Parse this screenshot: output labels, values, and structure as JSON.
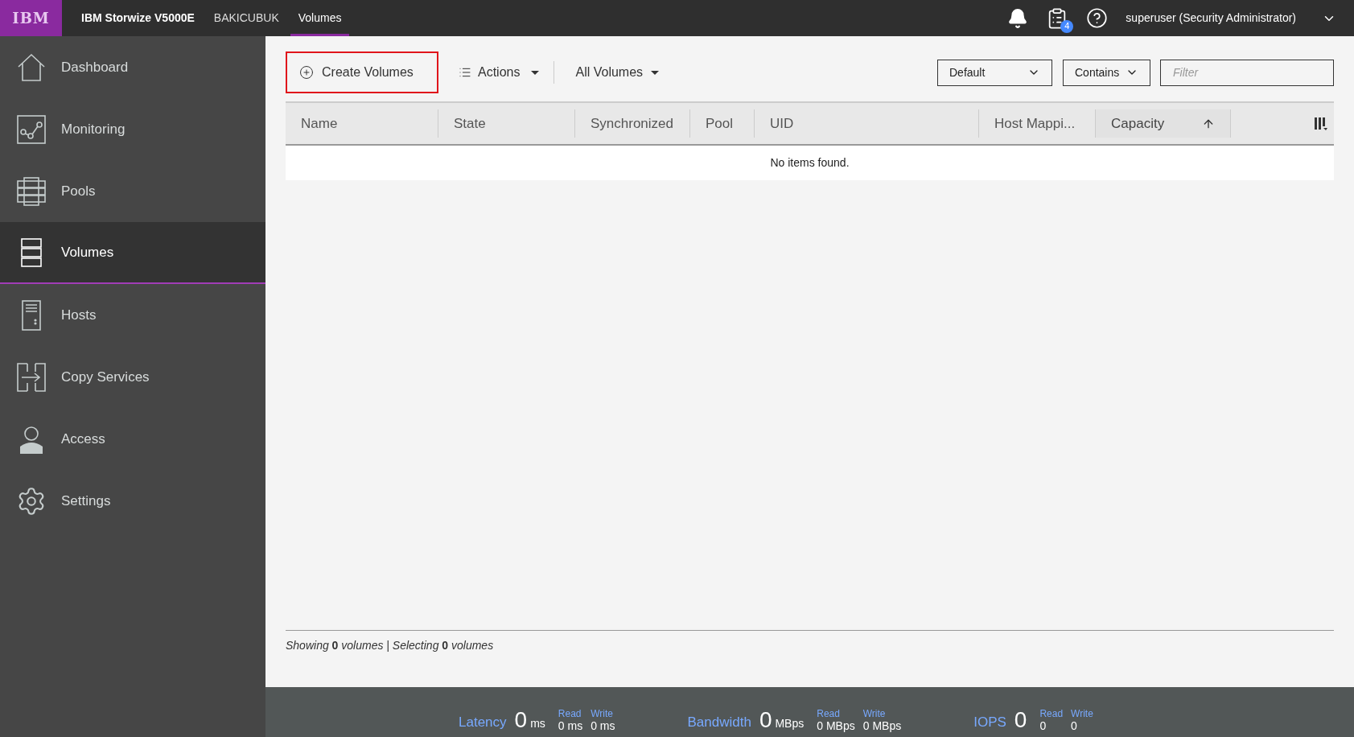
{
  "topbar": {
    "logo": "IBM",
    "product": "IBM Storwize V5000E",
    "system": "BAKICUBUK",
    "current": "Volumes",
    "tasks_badge": "4",
    "user": "superuser (Security Administrator)"
  },
  "sidebar": {
    "items": [
      {
        "label": "Dashboard",
        "selected": false
      },
      {
        "label": "Monitoring",
        "selected": false
      },
      {
        "label": "Pools",
        "selected": false
      },
      {
        "label": "Volumes",
        "selected": true
      },
      {
        "label": "Hosts",
        "selected": false
      },
      {
        "label": "Copy Services",
        "selected": false
      },
      {
        "label": "Access",
        "selected": false
      },
      {
        "label": "Settings",
        "selected": false
      }
    ]
  },
  "toolbar": {
    "create": "Create Volumes",
    "actions": "Actions",
    "view": "All Volumes",
    "filter_scope": "Default",
    "filter_mode": "Contains",
    "filter": {
      "placeholder": "Filter"
    }
  },
  "table": {
    "columns": [
      {
        "label": "Name",
        "sorted": false
      },
      {
        "label": "State",
        "sorted": false
      },
      {
        "label": "Synchronized",
        "sorted": false
      },
      {
        "label": "Pool",
        "sorted": false
      },
      {
        "label": "UID",
        "sorted": false
      },
      {
        "label": "Host Mappi...",
        "sorted": false
      },
      {
        "label": "Capacity",
        "sorted": true
      }
    ],
    "empty": "No items found."
  },
  "status": "*Showing* **0** *volumes | Selecting* **0** *volumes*",
  "stats": [
    {
      "label": "Latency",
      "value": "0",
      "unit": "ms",
      "read_label": "Read",
      "read": "0 ms",
      "write_label": "Write",
      "write": "0 ms"
    },
    {
      "label": "Bandwidth",
      "value": "0",
      "unit": "MBps",
      "read_label": "Read",
      "read": "0 MBps",
      "write_label": "Write",
      "write": "0 MBps"
    },
    {
      "label": "IOPS",
      "value": "0",
      "read_label": "Read",
      "read": "0",
      "write_label": "Write",
      "write": "0"
    }
  ]
}
